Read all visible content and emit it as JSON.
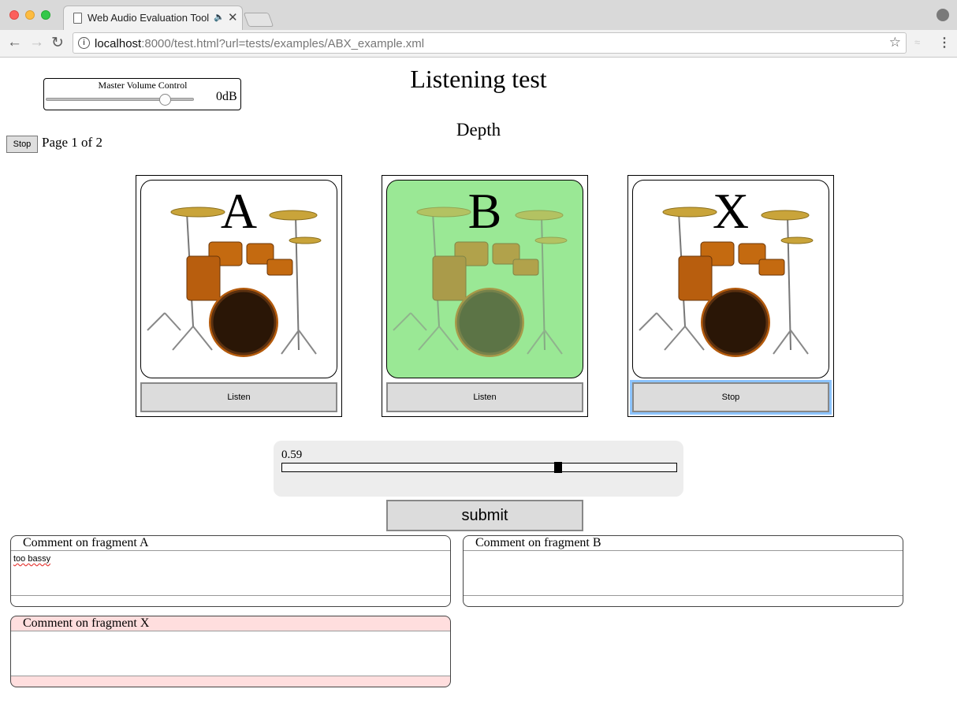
{
  "browser": {
    "tab_title": "Web Audio Evaluation Tool",
    "url_host": "localhost",
    "url_rest": ":8000/test.html?url=tests/examples/ABX_example.xml",
    "icons": [
      "page-icon",
      "speaker-icon",
      "close-icon",
      "back-icon",
      "forward-icon",
      "reload-icon",
      "info-icon",
      "star-icon",
      "menu-icon",
      "profile-icon"
    ]
  },
  "volume": {
    "label": "Master Volume Control",
    "value": "0dB",
    "level": 0.82
  },
  "header": {
    "title": "Listening test",
    "subtitle": "Depth"
  },
  "controls": {
    "stop_label": "Stop",
    "page_indicator": "Page 1 of 2"
  },
  "fragments": [
    {
      "label": "A",
      "button": "Listen",
      "selected": false,
      "image": "drum-kit-image"
    },
    {
      "label": "B",
      "button": "Listen",
      "selected": true,
      "image": "drum-kit-image"
    },
    {
      "label": "X",
      "button": "Stop",
      "selected": false,
      "image": "drum-kit-image"
    }
  ],
  "rating": {
    "value": "0.59",
    "position": 0.7
  },
  "submit_label": "submit",
  "comments": [
    {
      "title": "Comment on fragment A",
      "text": "too bassy"
    },
    {
      "title": "Comment on fragment B",
      "text": ""
    },
    {
      "title": "Comment on fragment X",
      "text": ""
    }
  ],
  "colors": {
    "selected_fragment": "#9ae895",
    "highlight_comment": "#ffdede",
    "panel": "#ededed"
  }
}
